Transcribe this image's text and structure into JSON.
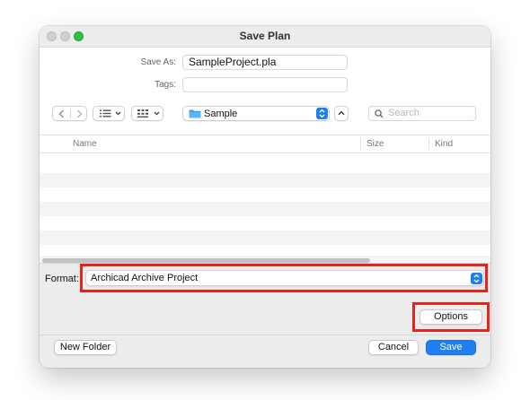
{
  "window": {
    "title": "Save Plan"
  },
  "form": {
    "save_as_label": "Save As:",
    "save_as_value": "SampleProject.pla",
    "tags_label": "Tags:",
    "tags_value": ""
  },
  "toolbar": {
    "back_icon": "chevron-left",
    "forward_icon": "chevron-right",
    "list_view_icon": "list",
    "grid_view_icon": "grid",
    "location": "Sample",
    "search_placeholder": "Search"
  },
  "file_list": {
    "columns": [
      "Name",
      "Size",
      "Kind"
    ],
    "rows": []
  },
  "format": {
    "label": "Format:",
    "value": "Archicad Archive Project"
  },
  "buttons": {
    "options": "Options",
    "new_folder": "New Folder",
    "cancel": "Cancel",
    "save": "Save"
  },
  "colors": {
    "accent": "#1f7ff0",
    "highlight": "#e8231a",
    "close_light": "#d0d0d0",
    "zoom_light": "#2dc240"
  }
}
